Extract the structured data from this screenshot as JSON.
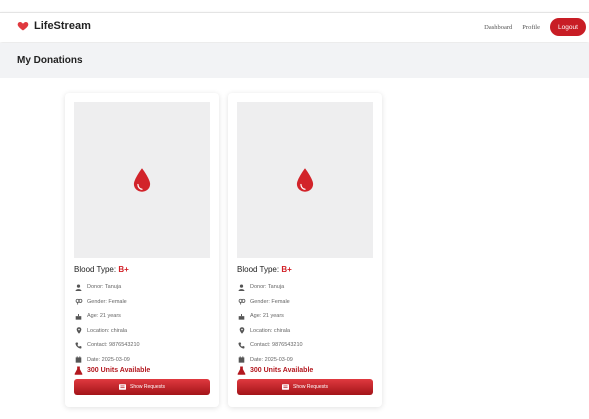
{
  "app": {
    "name": "LifeStream"
  },
  "nav": {
    "dashboard": "Dashboard",
    "profile": "Profile",
    "logout": "Logout"
  },
  "page": {
    "title": "My Donations"
  },
  "colors": {
    "brand_red": "#c81d25",
    "accent_red": "#d21f26",
    "placeholder_gray": "#eeeeef"
  },
  "donations": [
    {
      "blood_type_label": "Blood Type:",
      "blood_type": "B+",
      "donor": "Donor: Tanuja",
      "gender": "Gender: Female",
      "age": "Age: 21 years",
      "location": "Location: chirala",
      "contact": "Contact: 9876543210",
      "date": "Date: 2025-03-09",
      "units": "300 Units Available",
      "button": "Show Requests"
    },
    {
      "blood_type_label": "Blood Type:",
      "blood_type": "B+",
      "donor": "Donor: Tanuja",
      "gender": "Gender: Female",
      "age": "Age: 21 years",
      "location": "Location: chirala",
      "contact": "Contact: 9876543210",
      "date": "Date: 2025-03-09",
      "units": "300 Units Available",
      "button": "Show Requests"
    }
  ]
}
